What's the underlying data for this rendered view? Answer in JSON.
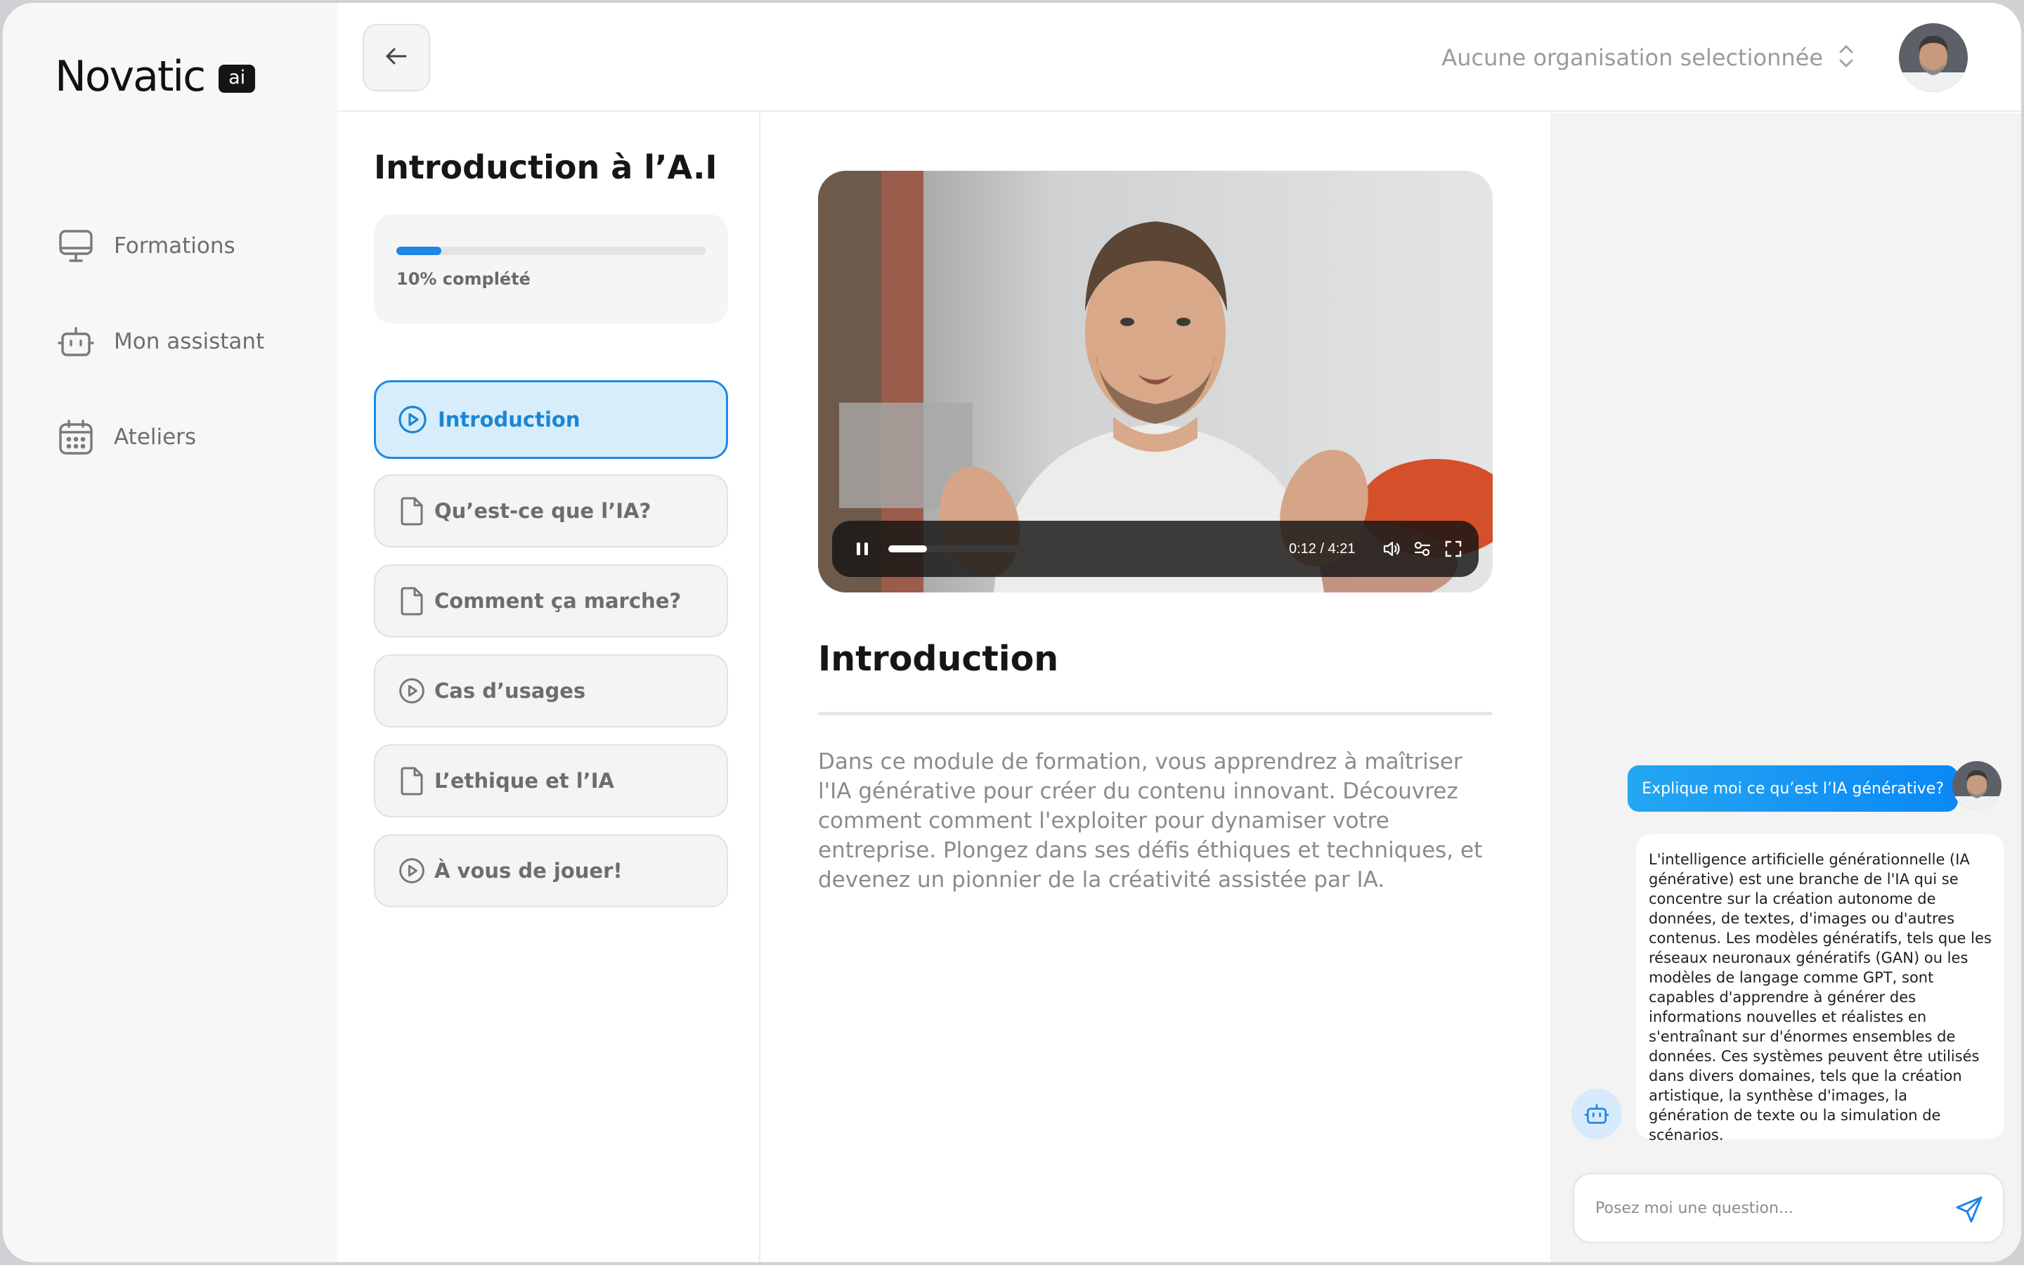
{
  "brand": {
    "name": "Novatic",
    "badge": "ai",
    "accent": "#1F86E8"
  },
  "sidebar": {
    "items": [
      {
        "label": "Formations",
        "icon": "monitor-icon"
      },
      {
        "label": "Mon assistant",
        "icon": "robot-icon"
      },
      {
        "label": "Ateliers",
        "icon": "calendar-icon"
      }
    ]
  },
  "topbar": {
    "back_icon": "arrow-left-icon",
    "organization": {
      "label": "Aucune organisation selectionnée",
      "icon": "chevron-up-down-icon"
    }
  },
  "module": {
    "title": "Introduction à l’A.I",
    "progress": {
      "value_percent": 10,
      "label": "10% complété"
    },
    "lessons": [
      {
        "label": "Introduction",
        "icon": "play-circle-icon",
        "active": true
      },
      {
        "label": "Qu’est-ce que l’IA?",
        "icon": "document-icon",
        "active": false
      },
      {
        "label": "Comment ça marche?",
        "icon": "document-icon",
        "active": false
      },
      {
        "label": "Cas d’usages",
        "icon": "play-circle-icon",
        "active": false
      },
      {
        "label": "L’ethique et l’IA",
        "icon": "document-icon",
        "active": false
      },
      {
        "label": "À vous de jouer!",
        "icon": "play-circle-icon",
        "active": false
      }
    ]
  },
  "content": {
    "video": {
      "time": "0:12 / 4:21",
      "progress_fraction": 0.046,
      "state": "playing"
    },
    "title": "Introduction",
    "description": "Dans ce module de formation, vous apprendrez à maîtriser l'IA générative pour créer du contenu innovant. Découvrez comment comment l'exploiter pour dynamiser votre entreprise. Plongez dans ses défis éthiques et techniques, et devenez un pionnier de la créativité assistée par IA."
  },
  "chat": {
    "user_message": "Explique moi ce qu’est l’IA générative?",
    "bot_message": "L'intelligence artificielle générationnelle (IA générative) est une branche de l'IA qui se concentre sur la création autonome de données, de textes, d'images ou d'autres contenus. Les modèles génératifs, tels que les réseaux neuronaux génératifs (GAN) ou les modèles de langage comme GPT, sont capables d'apprendre à générer des informations nouvelles et réalistes en s'entraînant sur d'énormes ensembles de données. Ces systèmes peuvent être utilisés dans divers domaines, tels que la création artistique, la synthèse d'images, la génération de texte ou la simulation de scénarios.",
    "input_placeholder": "Posez moi une question...",
    "send_icon": "send-icon"
  }
}
